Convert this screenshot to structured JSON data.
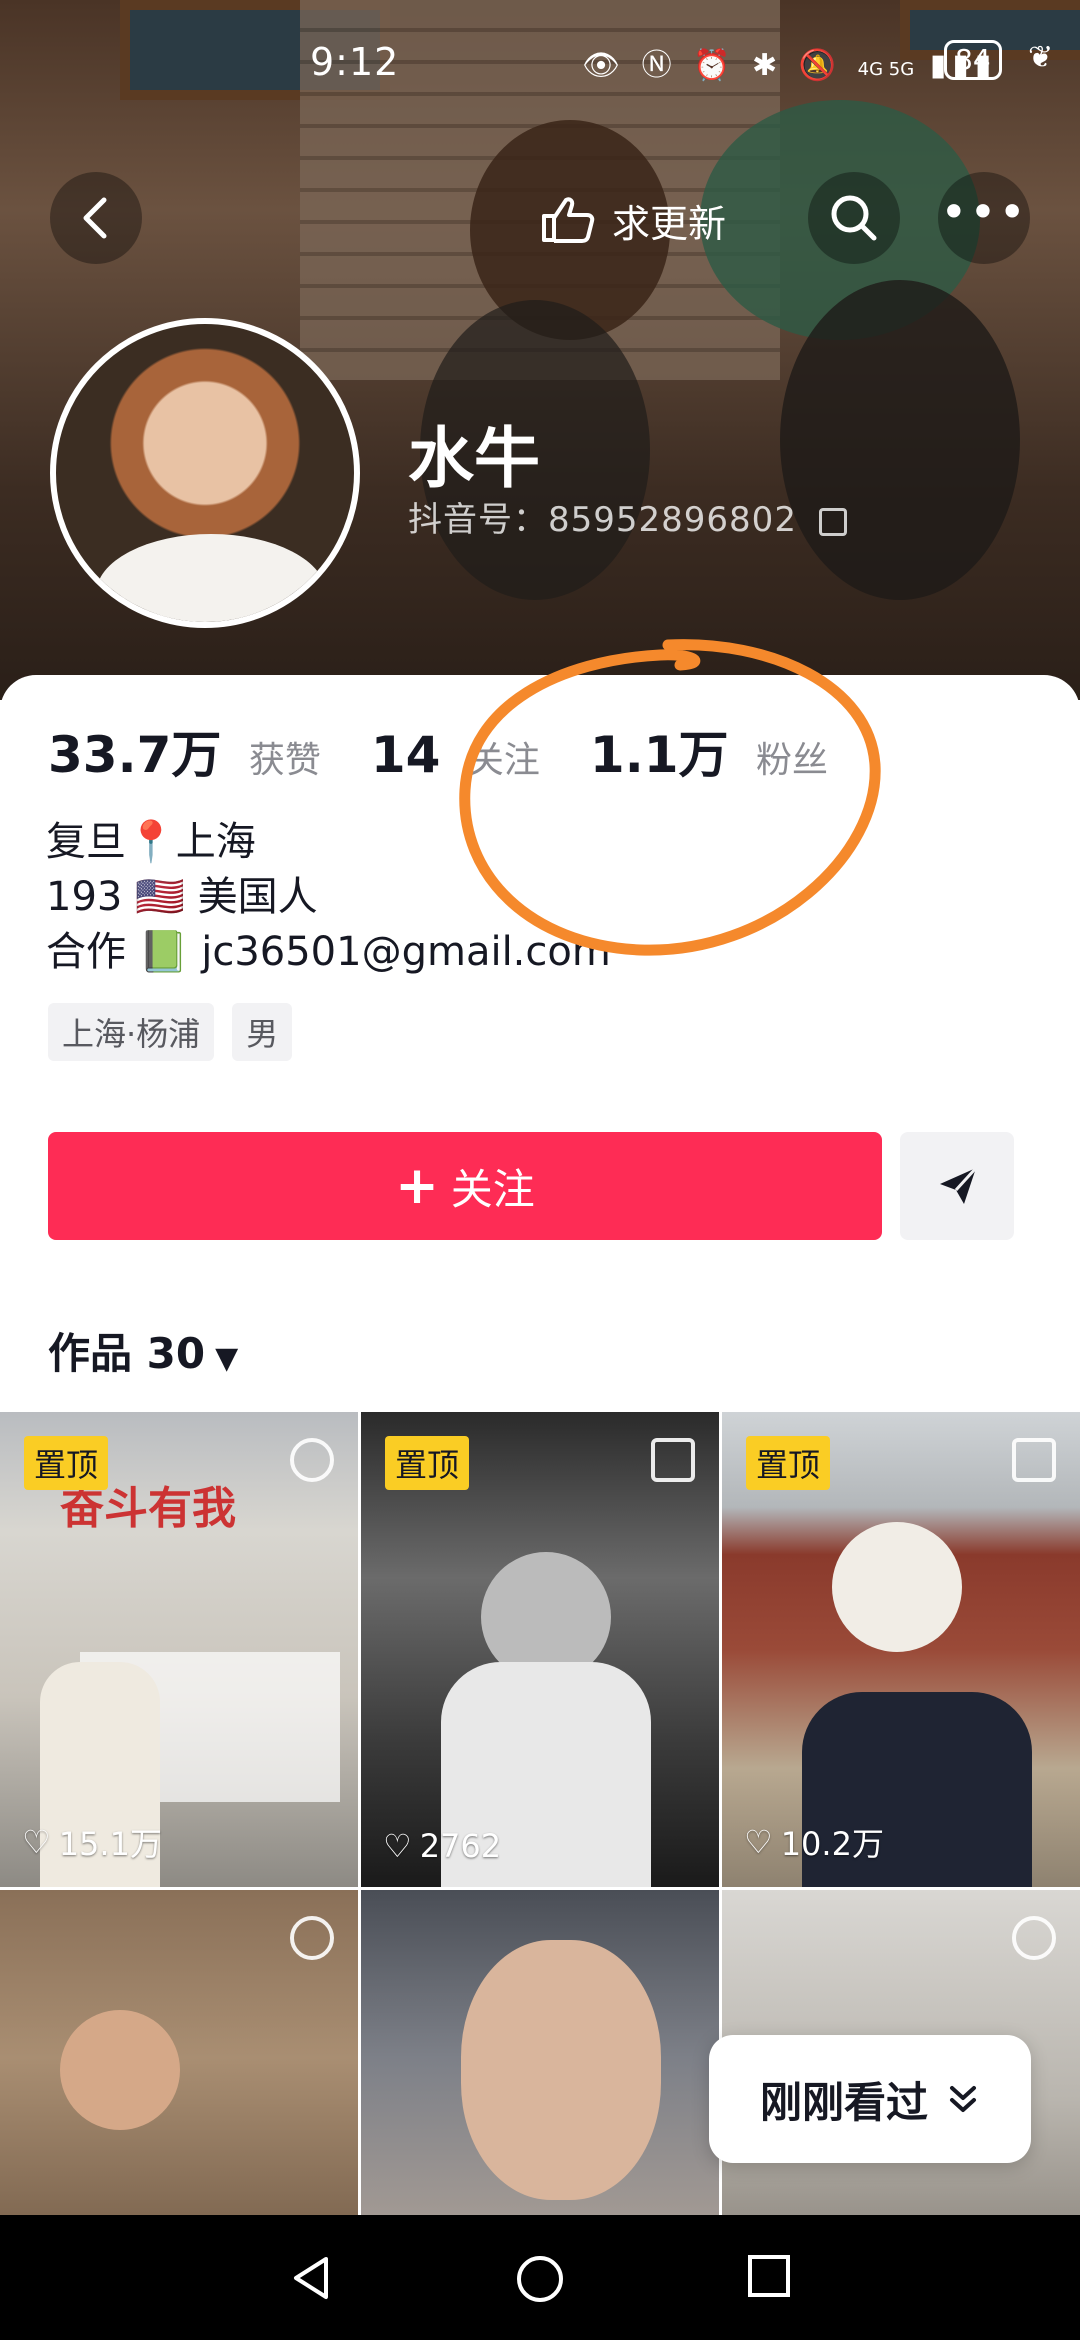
{
  "status_bar": {
    "time": "9:12",
    "battery": "84",
    "network": "4G 5G"
  },
  "header": {
    "request_update_label": "求更新"
  },
  "profile": {
    "name": "水牛",
    "douyin_id": "抖音号：85952896802",
    "stats": [
      {
        "value": "33.7万",
        "label": "获赞"
      },
      {
        "value": "14",
        "label": "关注"
      },
      {
        "value": "1.1万",
        "label": "粉丝"
      }
    ],
    "bio_lines": [
      "复旦📍上海",
      "193 🇺🇸 美国人",
      "合作 📗 jc36501@gmail.com"
    ],
    "tags": [
      "上海·杨浦",
      "男"
    ]
  },
  "actions": {
    "follow_label": "关注"
  },
  "works": {
    "tab_label": "作品 30"
  },
  "videos": [
    {
      "pinned": "置顶",
      "likes": "15.1万",
      "icon": "live-photo-icon"
    },
    {
      "pinned": "置顶",
      "likes": "2762",
      "icon": "multi-image-icon"
    },
    {
      "pinned": "置顶",
      "likes": "10.2万",
      "icon": "multi-image-icon"
    },
    {
      "pinned": "",
      "likes": "",
      "icon": "live-photo-icon"
    },
    {
      "pinned": "",
      "likes": "",
      "icon": ""
    },
    {
      "pinned": "",
      "likes": "",
      "icon": "live-photo-icon"
    }
  ],
  "recent_button": {
    "label": "刚刚看过"
  },
  "colors": {
    "follow_button": "#fe2c55",
    "pinned_badge": "#facd24",
    "annotation_circle": "#f5892c"
  }
}
